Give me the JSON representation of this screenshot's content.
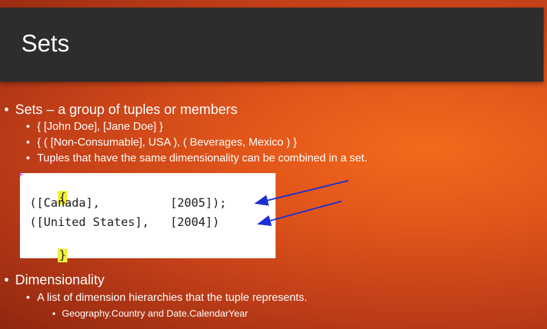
{
  "slide": {
    "title": "Sets",
    "bullets": [
      {
        "level": 1,
        "text": "Sets – a group of tuples or members"
      },
      {
        "level": 2,
        "text": "{ [John Doe], [Jane Doe] }"
      },
      {
        "level": 2,
        "text": "{ ( [Non-Consumable], USA ), ( Beverages, Mexico ) }"
      },
      {
        "level": 2,
        "text": "Tuples that have the same dimensionality can be combined in a set."
      },
      {
        "level": 1,
        "text": "Dimensionality"
      },
      {
        "level": 2,
        "text": "A list of dimension hierarchies that the tuple represents."
      },
      {
        "level": 3,
        "text": "Geography.Country and Date.CalendarYear"
      }
    ],
    "bullet_glyph": "•"
  },
  "code": {
    "open_brace": "{",
    "line1": "([Canada],          [2005]);",
    "line2": "([United States],   [2004])",
    "close_brace": "}"
  },
  "colors": {
    "title_bar": "#2d2d2d",
    "background_accent": "#e2561a",
    "highlight": "#f2ee3c",
    "arrow": "#1a2fd6"
  }
}
